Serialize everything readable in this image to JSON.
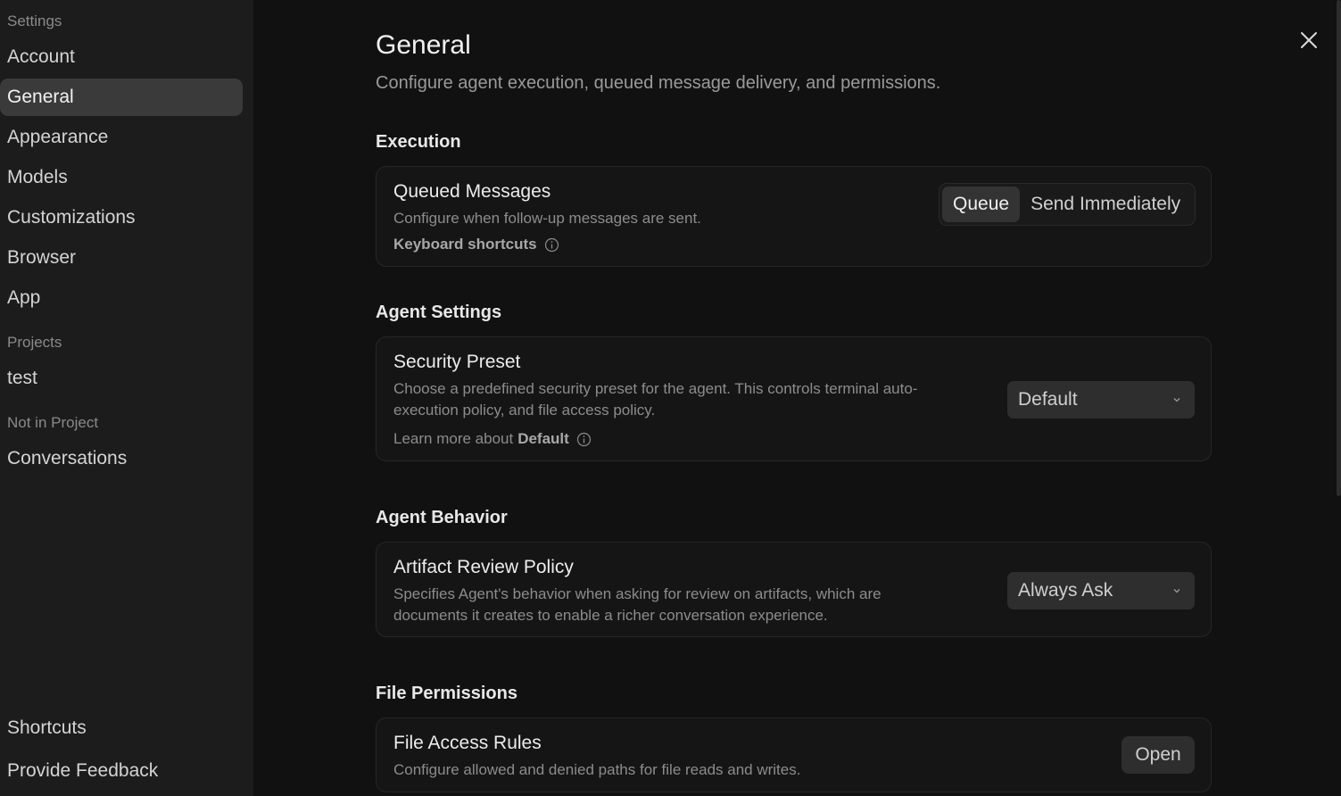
{
  "sidebar": {
    "settings_heading": "Settings",
    "items": [
      {
        "label": "Account"
      },
      {
        "label": "General"
      },
      {
        "label": "Appearance"
      },
      {
        "label": "Models"
      },
      {
        "label": "Customizations"
      },
      {
        "label": "Browser"
      },
      {
        "label": "App"
      }
    ],
    "projects_heading": "Projects",
    "projects": [
      {
        "label": "test"
      }
    ],
    "not_in_project_heading": "Not in Project",
    "conversations": [
      {
        "label": "Conversations"
      }
    ],
    "footer": [
      {
        "label": "Shortcuts"
      },
      {
        "label": "Provide Feedback"
      }
    ],
    "active_item": "General"
  },
  "main": {
    "title": "General",
    "subtitle": "Configure agent execution, queued message delivery, and permissions.",
    "close_icon": "close-icon",
    "sections": {
      "execution": {
        "title": "Execution",
        "queued": {
          "title": "Queued Messages",
          "description": "Configure when follow-up messages are sent.",
          "link": "Keyboard shortcuts",
          "options": [
            "Queue",
            "Send Immediately"
          ],
          "selected": "Queue"
        }
      },
      "agent_settings": {
        "title": "Agent Settings",
        "security": {
          "title": "Security Preset",
          "description_line1": "Choose a predefined security preset for the agent. This controls terminal auto-",
          "description_line2": "execution policy, and file access policy.",
          "learn_prefix": "Learn more about",
          "learn_target": "Default",
          "value": "Default"
        }
      },
      "agent_behavior": {
        "title": "Agent Behavior",
        "artifact": {
          "title": "Artifact Review Policy",
          "description_line1": "Specifies Agent's behavior when asking for review on artifacts, which are",
          "description_line2": "documents it creates to enable a richer conversation experience.",
          "value": "Always Ask"
        }
      },
      "file_permissions": {
        "title": "File Permissions",
        "access": {
          "title": "File Access Rules",
          "description": "Configure allowed and denied paths for file reads and writes.",
          "button": "Open"
        }
      }
    }
  },
  "colors": {
    "background": "#111111",
    "sidebar": "#1c1c1c",
    "active_item": "#3a3a3a",
    "card_border": "#262626"
  }
}
